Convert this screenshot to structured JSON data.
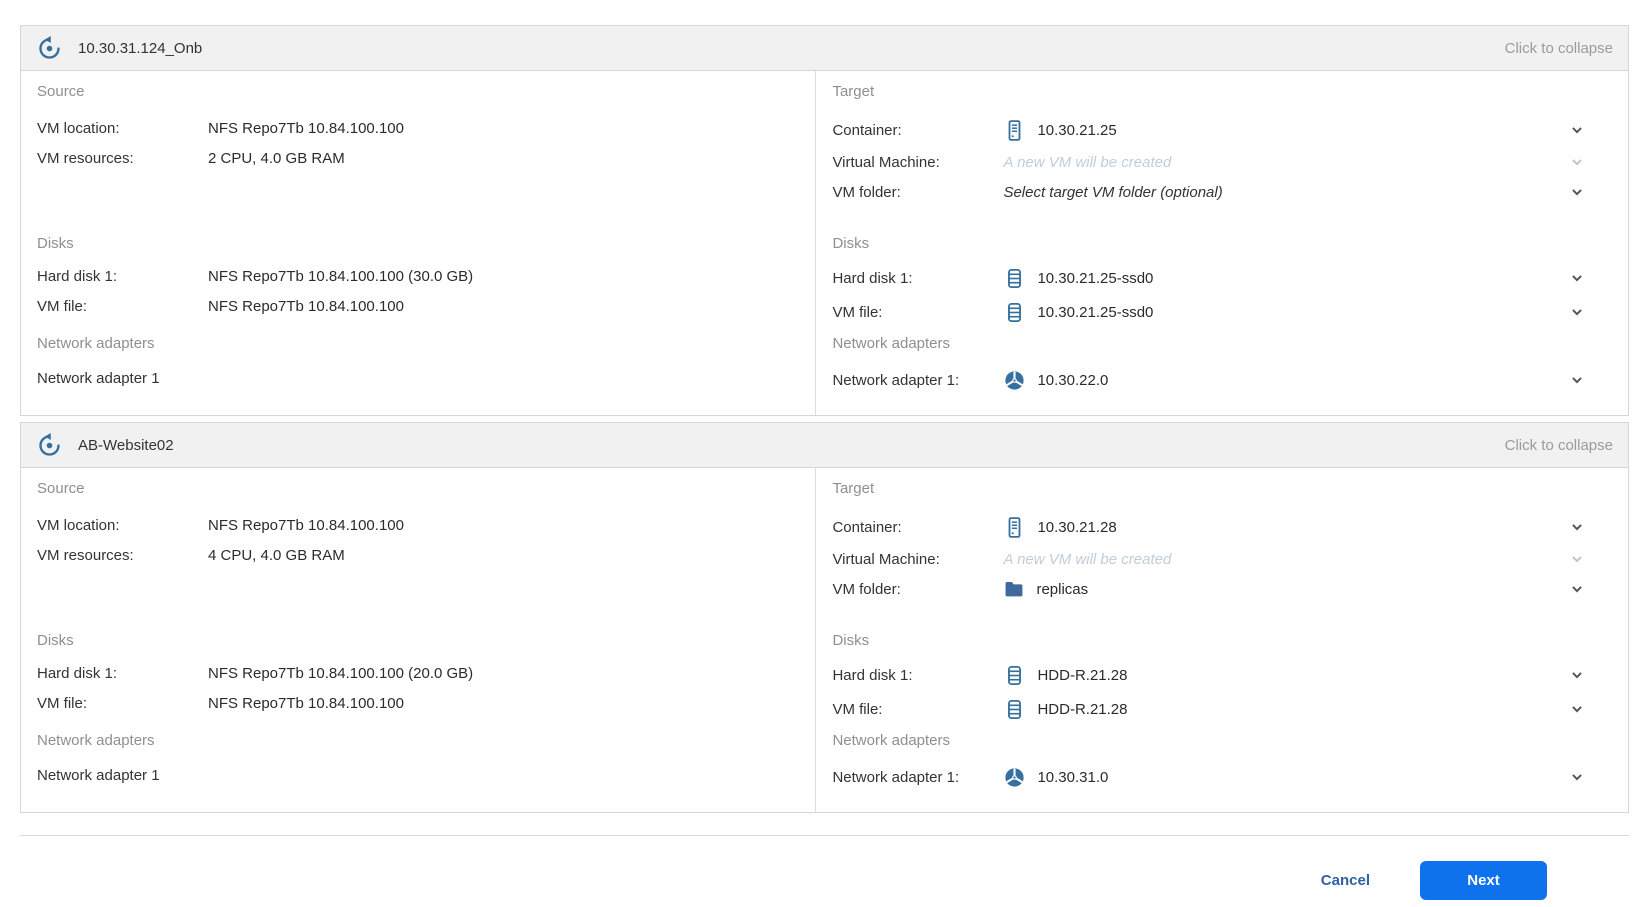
{
  "colors": {
    "icon_blue": "#35709e",
    "accent_blue": "#0e72ed",
    "cancel_blue": "#2e61a5",
    "header_gray": "#f1f1f1",
    "placeholder_gray": "#c2cdd9"
  },
  "icons": {
    "panel_header": "replica-icon",
    "container": "host-icon",
    "disk": "datastore-icon",
    "network": "network-icon",
    "folder": "folder-icon",
    "dropdown": "chevron-down-icon"
  },
  "labels": {
    "source_section": "Source",
    "target_section": "Target",
    "disks_section": "Disks",
    "network_section": "Network adapters",
    "vm_location": "VM location:",
    "vm_resources": "VM resources:",
    "hard_disk": "Hard disk 1:",
    "vm_file": "VM file:",
    "container": "Container:",
    "virtual_machine": "Virtual Machine:",
    "vm_folder": "VM folder:",
    "network_adapter": "Network adapter 1:",
    "network_adapter_plain": "Network adapter 1"
  },
  "panels": [
    {
      "title": "10.30.31.124_Onb",
      "collapse_label": "Click to collapse",
      "source": {
        "vm_location_value": "NFS Repo7Tb 10.84.100.100",
        "vm_resources_value": "2 CPU, 4.0 GB RAM",
        "hard_disk_value": "NFS Repo7Tb 10.84.100.100 (30.0 GB)",
        "vm_file_value": "NFS Repo7Tb 10.84.100.100"
      },
      "target": {
        "container_value": "10.30.21.25",
        "vm_placeholder": "A new VM will be created",
        "vm_folder_placeholder": "Select target VM folder (optional)",
        "hard_disk_value": "10.30.21.25-ssd0",
        "vm_file_value": "10.30.21.25-ssd0",
        "network_adapter_value": "10.30.22.0"
      }
    },
    {
      "title": "AB-Website02",
      "collapse_label": "Click to collapse",
      "source": {
        "vm_location_value": "NFS Repo7Tb 10.84.100.100",
        "vm_resources_value": "4 CPU, 4.0 GB RAM",
        "hard_disk_value": "NFS Repo7Tb 10.84.100.100 (20.0 GB)",
        "vm_file_value": "NFS Repo7Tb 10.84.100.100"
      },
      "target": {
        "container_value": "10.30.21.28",
        "vm_placeholder": "A new VM will be created",
        "vm_folder_value": "replicas",
        "hard_disk_value": "HDD-R.21.28",
        "vm_file_value": "HDD-R.21.28",
        "network_adapter_value": "10.30.31.0"
      }
    }
  ],
  "footer": {
    "cancel_label": "Cancel",
    "next_label": "Next"
  }
}
